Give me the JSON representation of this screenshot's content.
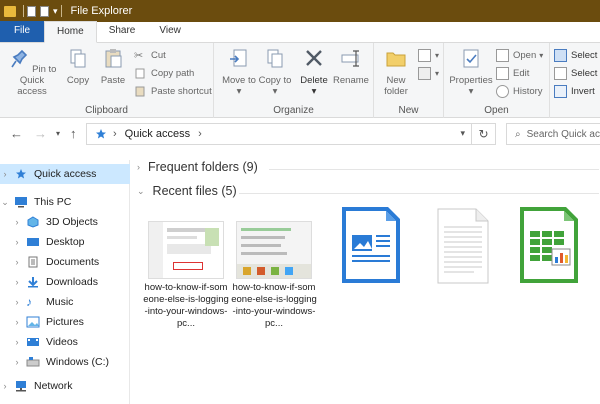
{
  "window": {
    "title": "File Explorer"
  },
  "tabs": [
    {
      "label": "File"
    },
    {
      "label": "Home"
    },
    {
      "label": "Share"
    },
    {
      "label": "View"
    }
  ],
  "ribbon": {
    "clipboard": {
      "label": "Clipboard",
      "pin": "Pin to Quick access",
      "copy": "Copy",
      "paste": "Paste",
      "cut": "Cut",
      "copy_path": "Copy path",
      "paste_shortcut": "Paste shortcut"
    },
    "organize": {
      "label": "Organize",
      "move_to": "Move to",
      "copy_to": "Copy to",
      "delete": "Delete",
      "rename": "Rename"
    },
    "new": {
      "label": "New",
      "new_folder": "New folder"
    },
    "open": {
      "label": "Open",
      "properties": "Properties",
      "open": "Open",
      "edit": "Edit",
      "history": "History"
    },
    "select": {
      "select_all": "Select",
      "select_none": "Select",
      "invert": "Invert"
    }
  },
  "address": {
    "location": "Quick access",
    "search_placeholder": "Search Quick access"
  },
  "navpane": {
    "quick_access": "Quick access",
    "this_pc": "This PC",
    "items": [
      "3D Objects",
      "Desktop",
      "Documents",
      "Downloads",
      "Music",
      "Pictures",
      "Videos",
      "Windows (C:)"
    ],
    "network": "Network"
  },
  "content": {
    "frequent": "Frequent folders (9)",
    "recent": "Recent files (5)",
    "files": [
      {
        "name": "how-to-know-if-someone-else-is-logging-into-your-windows-pc..."
      },
      {
        "name": "how-to-know-if-someone-else-is-logging-into-your-windows-pc..."
      }
    ]
  },
  "colors": {
    "titlebar": "#6b4c0e",
    "file_tab": "#1f5fae",
    "selection": "#cce8ff"
  }
}
